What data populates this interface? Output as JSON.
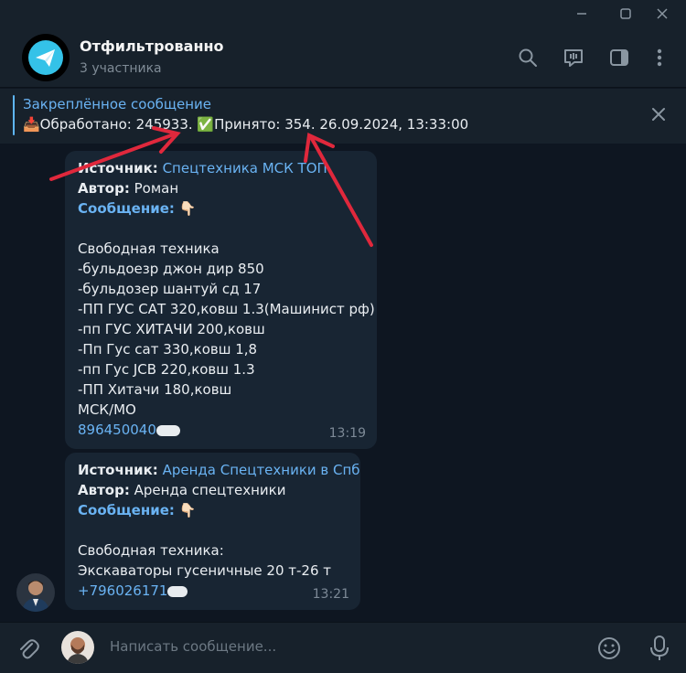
{
  "window": {
    "controls": [
      "minimize",
      "maximize",
      "close"
    ]
  },
  "header": {
    "title": "Отфильтрованно",
    "subtitle": "3 участника",
    "icons": [
      "search-icon",
      "live-chat-icon",
      "sidebar-toggle-icon",
      "more-options-icon"
    ]
  },
  "pinned": {
    "title": "Закреплённое сообщение",
    "text": "📥Обработано: 245933.  ✅Принято: 354. 26.09.2024, 13:33:00"
  },
  "messages": [
    {
      "source_label": "Источник:",
      "source_value": "Спецтехника МСК ТОП",
      "author_label": "Автор:",
      "author_value": "Роман",
      "message_label": "Сообщение:",
      "pointer": "👇🏻",
      "lines": [
        "Свободная техника",
        "-бульдоезр джон дир 850",
        "-бульдозер шантуй сд 17",
        "-ПП ГУС САТ 320,ковш 1.3(Машинист рф)",
        "-пп ГУС ХИТАЧИ 200,ковш",
        "-Пп Гус сат 330,ковш 1,8",
        "-пп Гус JCB 220,ковш 1.3",
        "-ПП Хитачи 180,ковш",
        "МСК/МО"
      ],
      "phone": "896450040",
      "time": "13:19"
    },
    {
      "source_label": "Источник:",
      "source_value": "Аренда Спецтехники в Спб",
      "author_label": "Автор:",
      "author_value": "Аренда спецтехники",
      "message_label": "Сообщение:",
      "pointer": "👇🏻",
      "lines": [
        "Свободная техника:",
        "Экскаваторы гусеничные 20 т-26 т"
      ],
      "phone": "+796026171",
      "time": "13:21"
    }
  ],
  "composer": {
    "placeholder": "Написать сообщение...",
    "icons": [
      "attach-icon",
      "user-avatar",
      "emoji-icon",
      "microphone-icon"
    ]
  },
  "colors": {
    "background": "#0e1621",
    "panel": "#17212b",
    "bubble": "#182533",
    "link": "#6ab3f3",
    "annotation_arrow": "#e0283c"
  }
}
